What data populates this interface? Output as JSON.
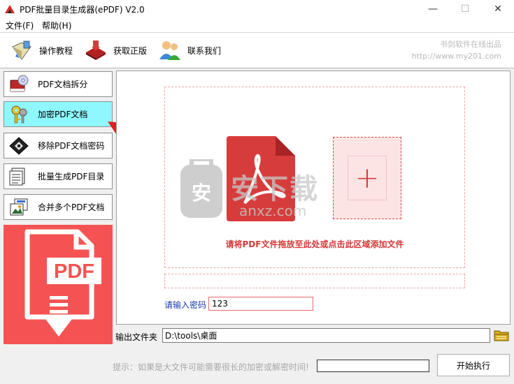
{
  "window": {
    "title": "PDF批量目录生成器(ePDF) V2.0",
    "min_glyph": "—",
    "max_glyph": "☐",
    "close_glyph": "✕"
  },
  "menu": {
    "file": "文件(F)",
    "help": "帮助(H)"
  },
  "toolbar": {
    "tutorial": "操作教程",
    "genuine": "获取正版",
    "contact": "联系我们",
    "brand_line1": "书剑软件在线出品",
    "brand_line2": "http://www.my201.com"
  },
  "sidebar": {
    "items": [
      {
        "label": "PDF文档拆分",
        "icon": "book-cd-icon"
      },
      {
        "label": "加密PDF文档",
        "icon": "keys-icon",
        "active": true
      },
      {
        "label": "移除PDF文档密码",
        "icon": "diamond-icon"
      },
      {
        "label": "批量生成PDF目录",
        "icon": "document-list-icon"
      },
      {
        "label": "合并多个PDF文档",
        "icon": "merge-pictures-icon"
      }
    ]
  },
  "banner": {
    "text": "PDF"
  },
  "main": {
    "drop_hint": "请将PDF文件拖放至此处或点击此区域添加文件",
    "add_glyph": "+",
    "password_label": "请输入密码",
    "password_value": "123"
  },
  "output": {
    "label": "输出文件夹",
    "path": "D:\\tools\\桌面"
  },
  "footer": {
    "hint": "提示：如果是大文件可能需要很长的加密或解密时间!",
    "start": "开始执行",
    "progress": 0
  },
  "watermark": {
    "text": "安下载",
    "sub": "anxz.com"
  },
  "colors": {
    "accent_red": "#d43838",
    "active_cyan": "#8ef7ff",
    "password_label": "#1a3da8"
  }
}
